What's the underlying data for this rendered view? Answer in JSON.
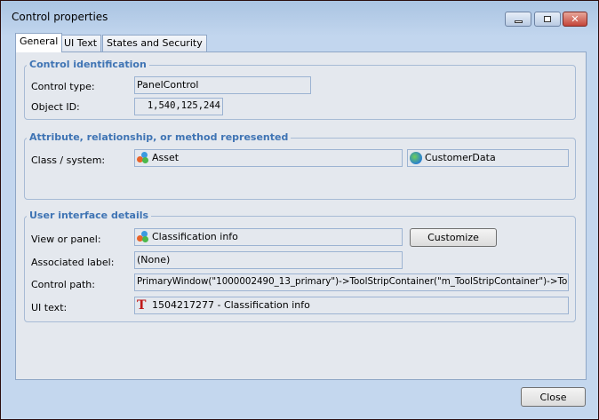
{
  "window": {
    "title": "Control properties",
    "minimize_icon": "minimize-icon",
    "maximize_icon": "restore-icon",
    "close_icon": "close-icon"
  },
  "tabs": [
    {
      "label": "General",
      "active": true
    },
    {
      "label": "UI Text"
    },
    {
      "label": "States and Security"
    }
  ],
  "control_identification": {
    "title": "Control identification",
    "control_type_label": "Control type:",
    "control_type": "PanelControl",
    "object_id_label": "Object ID:",
    "object_id": "1,540,125,244"
  },
  "attribute": {
    "title": "Attribute, relationship, or method represented",
    "class_label": "Class / system:",
    "class_value": "Asset",
    "class_icon": "class-bubbles-icon",
    "system_value": "CustomerData",
    "system_icon": "globe-icon"
  },
  "ui_details": {
    "title": "User interface details",
    "view_label": "View or panel:",
    "view_value": "Classification info",
    "view_icon": "class-bubbles-icon",
    "customize_label": "Customize",
    "assoc_label": "Associated label:",
    "assoc_value": "(None)",
    "path_label": "Control path:",
    "path_value": "PrimaryWindow(\"1000002490_13_primary\")->ToolStripContainer(\"m_ToolStripContainer\")->ToolStrip(",
    "ui_text_label": "UI text:",
    "ui_text_value": "1504217277 - Classification info",
    "ui_text_icon": "text-tt-icon"
  },
  "footer": {
    "close_label": "Close"
  }
}
